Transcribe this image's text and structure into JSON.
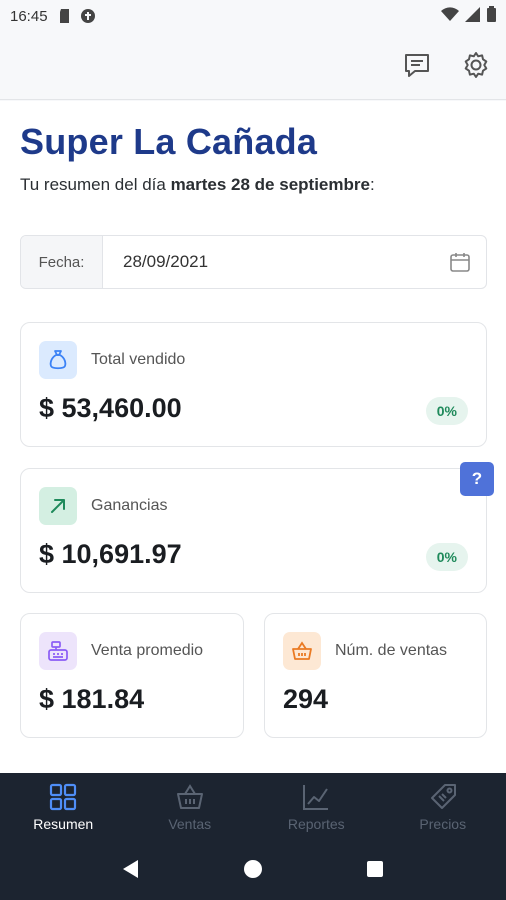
{
  "status": {
    "time": "16:45"
  },
  "app": {
    "store_name": "Super La Cañada",
    "summary_prefix": "Tu resumen del día ",
    "summary_date": "martes 28 de septiembre",
    "summary_suffix": ":"
  },
  "date_filter": {
    "label": "Fecha:",
    "value": "28/09/2021"
  },
  "cards": {
    "total_sold": {
      "label": "Total vendido",
      "value": "$ 53,460.00",
      "badge": "0%"
    },
    "profit": {
      "label": "Ganancias",
      "value": "$ 10,691.97",
      "badge": "0%"
    },
    "avg_sale": {
      "label": "Venta promedio",
      "value": "$ 181.84"
    },
    "num_sales": {
      "label": "Núm. de ventas",
      "value": "294"
    }
  },
  "help": {
    "label": "?"
  },
  "nav": {
    "items": [
      {
        "label": "Resumen",
        "icon": "grid-icon",
        "active": true
      },
      {
        "label": "Ventas",
        "icon": "basket-icon",
        "active": false
      },
      {
        "label": "Reportes",
        "icon": "chart-line-icon",
        "active": false
      },
      {
        "label": "Precios",
        "icon": "tag-icon",
        "active": false
      }
    ]
  },
  "colors": {
    "title": "#1e3a8a",
    "nav_bg": "#1c2430",
    "nav_active": "#4f8ef7",
    "badge_green": "#1f8a5b",
    "help_blue": "#4f72d9"
  }
}
